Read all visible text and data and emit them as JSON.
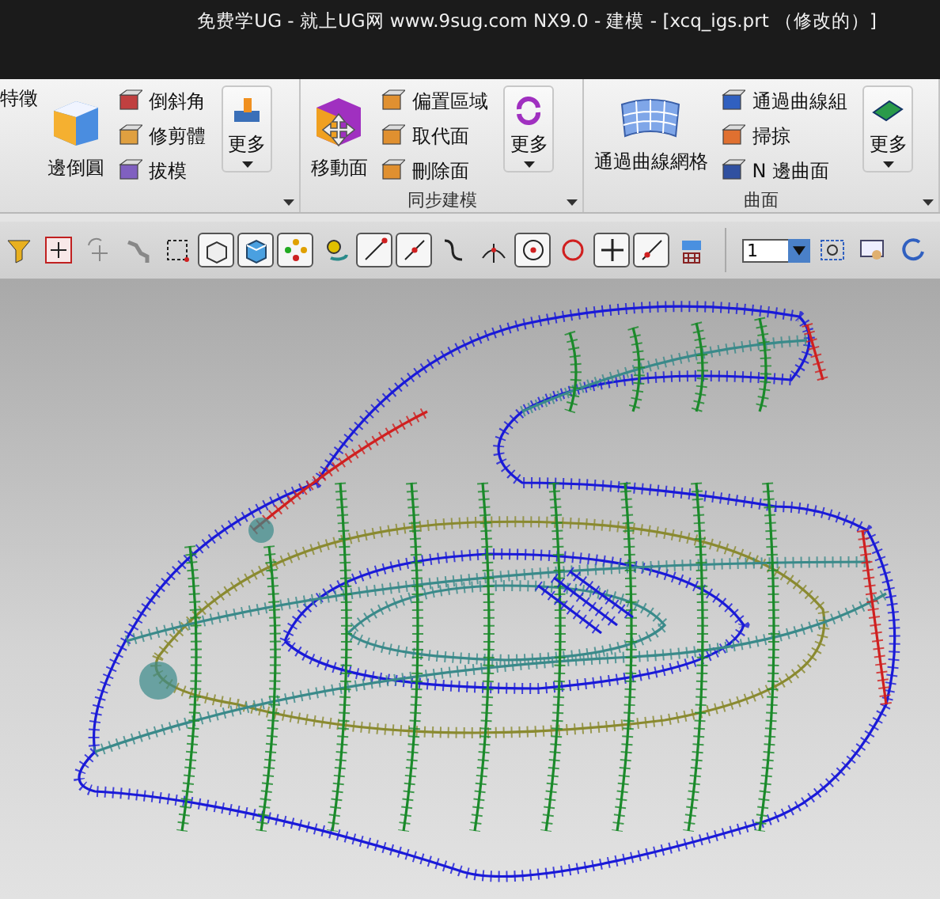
{
  "window": {
    "title": "免费学UG - 就上UG网 www.9sug.com   NX9.0 - 建模 - [xcq_igs.prt （修改的）]"
  },
  "ribbon": {
    "groups": [
      {
        "partial_item": "特徵",
        "large_button": "邊倒圓",
        "small_buttons": [
          "倒斜角",
          "修剪體",
          "拔模"
        ],
        "more": "更多"
      },
      {
        "large_button": "移動面",
        "small_buttons": [
          "偏置區域",
          "取代面",
          "刪除面"
        ],
        "more": "更多",
        "label": "同步建模"
      },
      {
        "large_button": "通過曲線網格",
        "small_buttons": [
          "通過曲線組",
          "掃掠",
          "N 邊曲面"
        ],
        "more": "更多",
        "label": "曲面"
      }
    ]
  },
  "toolbar": {
    "items": [
      {
        "kind": "filter",
        "pressed": false
      },
      {
        "kind": "snap",
        "pressed": false
      },
      {
        "kind": "undo-snap",
        "pressed": false
      },
      {
        "kind": "chain",
        "pressed": false
      },
      {
        "kind": "rect-select",
        "pressed": false
      },
      {
        "kind": "wire-solid",
        "pressed": true
      },
      {
        "kind": "shaded-solid",
        "pressed": true
      },
      {
        "kind": "points",
        "pressed": true
      },
      {
        "kind": "rotate-points",
        "pressed": false
      },
      {
        "kind": "line-end",
        "pressed": true
      },
      {
        "kind": "line-mid",
        "pressed": true
      },
      {
        "kind": "curve",
        "pressed": false
      },
      {
        "kind": "tangent",
        "pressed": false
      },
      {
        "kind": "circle-center",
        "pressed": true
      },
      {
        "kind": "circle-quad",
        "pressed": false
      },
      {
        "kind": "cross",
        "pressed": true
      },
      {
        "kind": "line-point",
        "pressed": true
      },
      {
        "kind": "view-stack",
        "pressed": false
      }
    ],
    "layer_value": "1",
    "tail": [
      {
        "kind": "zoom-fit"
      },
      {
        "kind": "pan"
      },
      {
        "kind": "rotate"
      }
    ]
  }
}
